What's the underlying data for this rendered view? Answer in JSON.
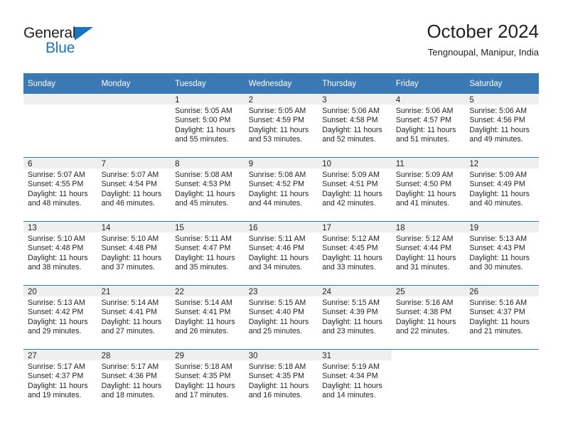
{
  "brand": {
    "name_part1": "General",
    "name_part2": "Blue",
    "triangle_color": "#1b75bc"
  },
  "header": {
    "title": "October 2024",
    "subtitle": "Tengnoupal, Manipur, India"
  },
  "theme": {
    "header_blue": "#3b79b5",
    "daynum_strip": "#efefef",
    "text": "#231f20"
  },
  "calendar": {
    "weekday_headers": [
      "Sunday",
      "Monday",
      "Tuesday",
      "Wednesday",
      "Thursday",
      "Friday",
      "Saturday"
    ],
    "weeks": [
      [
        {
          "day": "",
          "lines": []
        },
        {
          "day": "",
          "lines": []
        },
        {
          "day": "1",
          "lines": [
            "Sunrise: 5:05 AM",
            "Sunset: 5:00 PM",
            "Daylight: 11 hours",
            "and 55 minutes."
          ]
        },
        {
          "day": "2",
          "lines": [
            "Sunrise: 5:05 AM",
            "Sunset: 4:59 PM",
            "Daylight: 11 hours",
            "and 53 minutes."
          ]
        },
        {
          "day": "3",
          "lines": [
            "Sunrise: 5:06 AM",
            "Sunset: 4:58 PM",
            "Daylight: 11 hours",
            "and 52 minutes."
          ]
        },
        {
          "day": "4",
          "lines": [
            "Sunrise: 5:06 AM",
            "Sunset: 4:57 PM",
            "Daylight: 11 hours",
            "and 51 minutes."
          ]
        },
        {
          "day": "5",
          "lines": [
            "Sunrise: 5:06 AM",
            "Sunset: 4:56 PM",
            "Daylight: 11 hours",
            "and 49 minutes."
          ]
        }
      ],
      [
        {
          "day": "6",
          "lines": [
            "Sunrise: 5:07 AM",
            "Sunset: 4:55 PM",
            "Daylight: 11 hours",
            "and 48 minutes."
          ]
        },
        {
          "day": "7",
          "lines": [
            "Sunrise: 5:07 AM",
            "Sunset: 4:54 PM",
            "Daylight: 11 hours",
            "and 46 minutes."
          ]
        },
        {
          "day": "8",
          "lines": [
            "Sunrise: 5:08 AM",
            "Sunset: 4:53 PM",
            "Daylight: 11 hours",
            "and 45 minutes."
          ]
        },
        {
          "day": "9",
          "lines": [
            "Sunrise: 5:08 AM",
            "Sunset: 4:52 PM",
            "Daylight: 11 hours",
            "and 44 minutes."
          ]
        },
        {
          "day": "10",
          "lines": [
            "Sunrise: 5:09 AM",
            "Sunset: 4:51 PM",
            "Daylight: 11 hours",
            "and 42 minutes."
          ]
        },
        {
          "day": "11",
          "lines": [
            "Sunrise: 5:09 AM",
            "Sunset: 4:50 PM",
            "Daylight: 11 hours",
            "and 41 minutes."
          ]
        },
        {
          "day": "12",
          "lines": [
            "Sunrise: 5:09 AM",
            "Sunset: 4:49 PM",
            "Daylight: 11 hours",
            "and 40 minutes."
          ]
        }
      ],
      [
        {
          "day": "13",
          "lines": [
            "Sunrise: 5:10 AM",
            "Sunset: 4:48 PM",
            "Daylight: 11 hours",
            "and 38 minutes."
          ]
        },
        {
          "day": "14",
          "lines": [
            "Sunrise: 5:10 AM",
            "Sunset: 4:48 PM",
            "Daylight: 11 hours",
            "and 37 minutes."
          ]
        },
        {
          "day": "15",
          "lines": [
            "Sunrise: 5:11 AM",
            "Sunset: 4:47 PM",
            "Daylight: 11 hours",
            "and 35 minutes."
          ]
        },
        {
          "day": "16",
          "lines": [
            "Sunrise: 5:11 AM",
            "Sunset: 4:46 PM",
            "Daylight: 11 hours",
            "and 34 minutes."
          ]
        },
        {
          "day": "17",
          "lines": [
            "Sunrise: 5:12 AM",
            "Sunset: 4:45 PM",
            "Daylight: 11 hours",
            "and 33 minutes."
          ]
        },
        {
          "day": "18",
          "lines": [
            "Sunrise: 5:12 AM",
            "Sunset: 4:44 PM",
            "Daylight: 11 hours",
            "and 31 minutes."
          ]
        },
        {
          "day": "19",
          "lines": [
            "Sunrise: 5:13 AM",
            "Sunset: 4:43 PM",
            "Daylight: 11 hours",
            "and 30 minutes."
          ]
        }
      ],
      [
        {
          "day": "20",
          "lines": [
            "Sunrise: 5:13 AM",
            "Sunset: 4:42 PM",
            "Daylight: 11 hours",
            "and 29 minutes."
          ]
        },
        {
          "day": "21",
          "lines": [
            "Sunrise: 5:14 AM",
            "Sunset: 4:41 PM",
            "Daylight: 11 hours",
            "and 27 minutes."
          ]
        },
        {
          "day": "22",
          "lines": [
            "Sunrise: 5:14 AM",
            "Sunset: 4:41 PM",
            "Daylight: 11 hours",
            "and 26 minutes."
          ]
        },
        {
          "day": "23",
          "lines": [
            "Sunrise: 5:15 AM",
            "Sunset: 4:40 PM",
            "Daylight: 11 hours",
            "and 25 minutes."
          ]
        },
        {
          "day": "24",
          "lines": [
            "Sunrise: 5:15 AM",
            "Sunset: 4:39 PM",
            "Daylight: 11 hours",
            "and 23 minutes."
          ]
        },
        {
          "day": "25",
          "lines": [
            "Sunrise: 5:16 AM",
            "Sunset: 4:38 PM",
            "Daylight: 11 hours",
            "and 22 minutes."
          ]
        },
        {
          "day": "26",
          "lines": [
            "Sunrise: 5:16 AM",
            "Sunset: 4:37 PM",
            "Daylight: 11 hours",
            "and 21 minutes."
          ]
        }
      ],
      [
        {
          "day": "27",
          "lines": [
            "Sunrise: 5:17 AM",
            "Sunset: 4:37 PM",
            "Daylight: 11 hours",
            "and 19 minutes."
          ]
        },
        {
          "day": "28",
          "lines": [
            "Sunrise: 5:17 AM",
            "Sunset: 4:36 PM",
            "Daylight: 11 hours",
            "and 18 minutes."
          ]
        },
        {
          "day": "29",
          "lines": [
            "Sunrise: 5:18 AM",
            "Sunset: 4:35 PM",
            "Daylight: 11 hours",
            "and 17 minutes."
          ]
        },
        {
          "day": "30",
          "lines": [
            "Sunrise: 5:18 AM",
            "Sunset: 4:35 PM",
            "Daylight: 11 hours",
            "and 16 minutes."
          ]
        },
        {
          "day": "31",
          "lines": [
            "Sunrise: 5:19 AM",
            "Sunset: 4:34 PM",
            "Daylight: 11 hours",
            "and 14 minutes."
          ]
        },
        {
          "day": "",
          "lines": []
        },
        {
          "day": "",
          "lines": []
        }
      ]
    ]
  }
}
